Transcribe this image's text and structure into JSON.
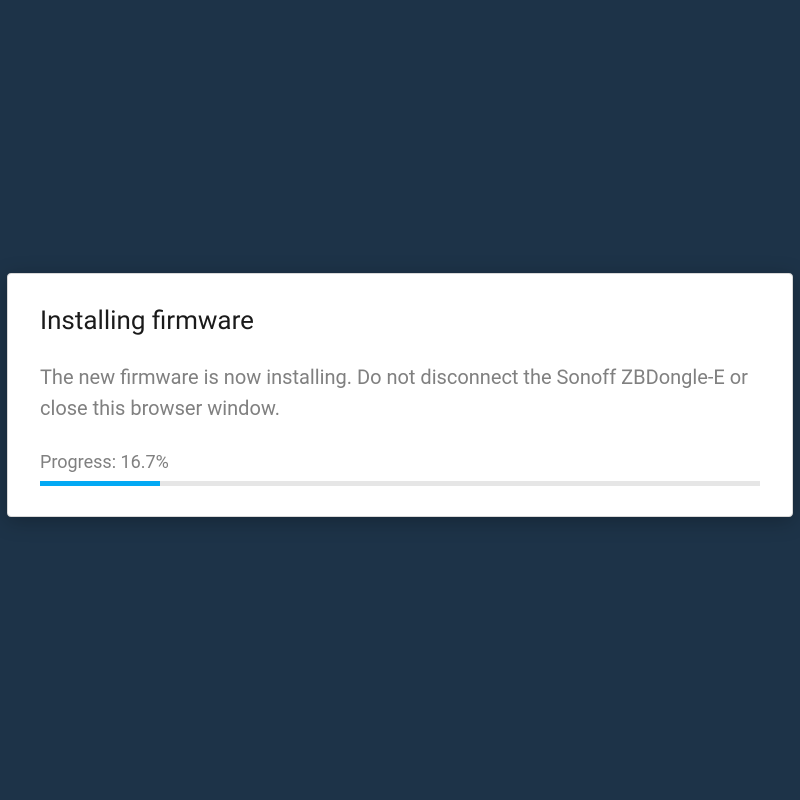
{
  "dialog": {
    "title": "Installing firmware",
    "description": "The new firmware is now installing. Do not disconnect the Sonoff ZBDongle-E or close this browser window.",
    "progress_label": "Progress: 16.7%",
    "progress_percent": 16.7
  },
  "colors": {
    "background": "#1d3348",
    "card_bg": "#ffffff",
    "accent": "#03a9f4",
    "text_primary": "#1a1a1a",
    "text_secondary": "#808080",
    "track": "#e6e6e6"
  }
}
